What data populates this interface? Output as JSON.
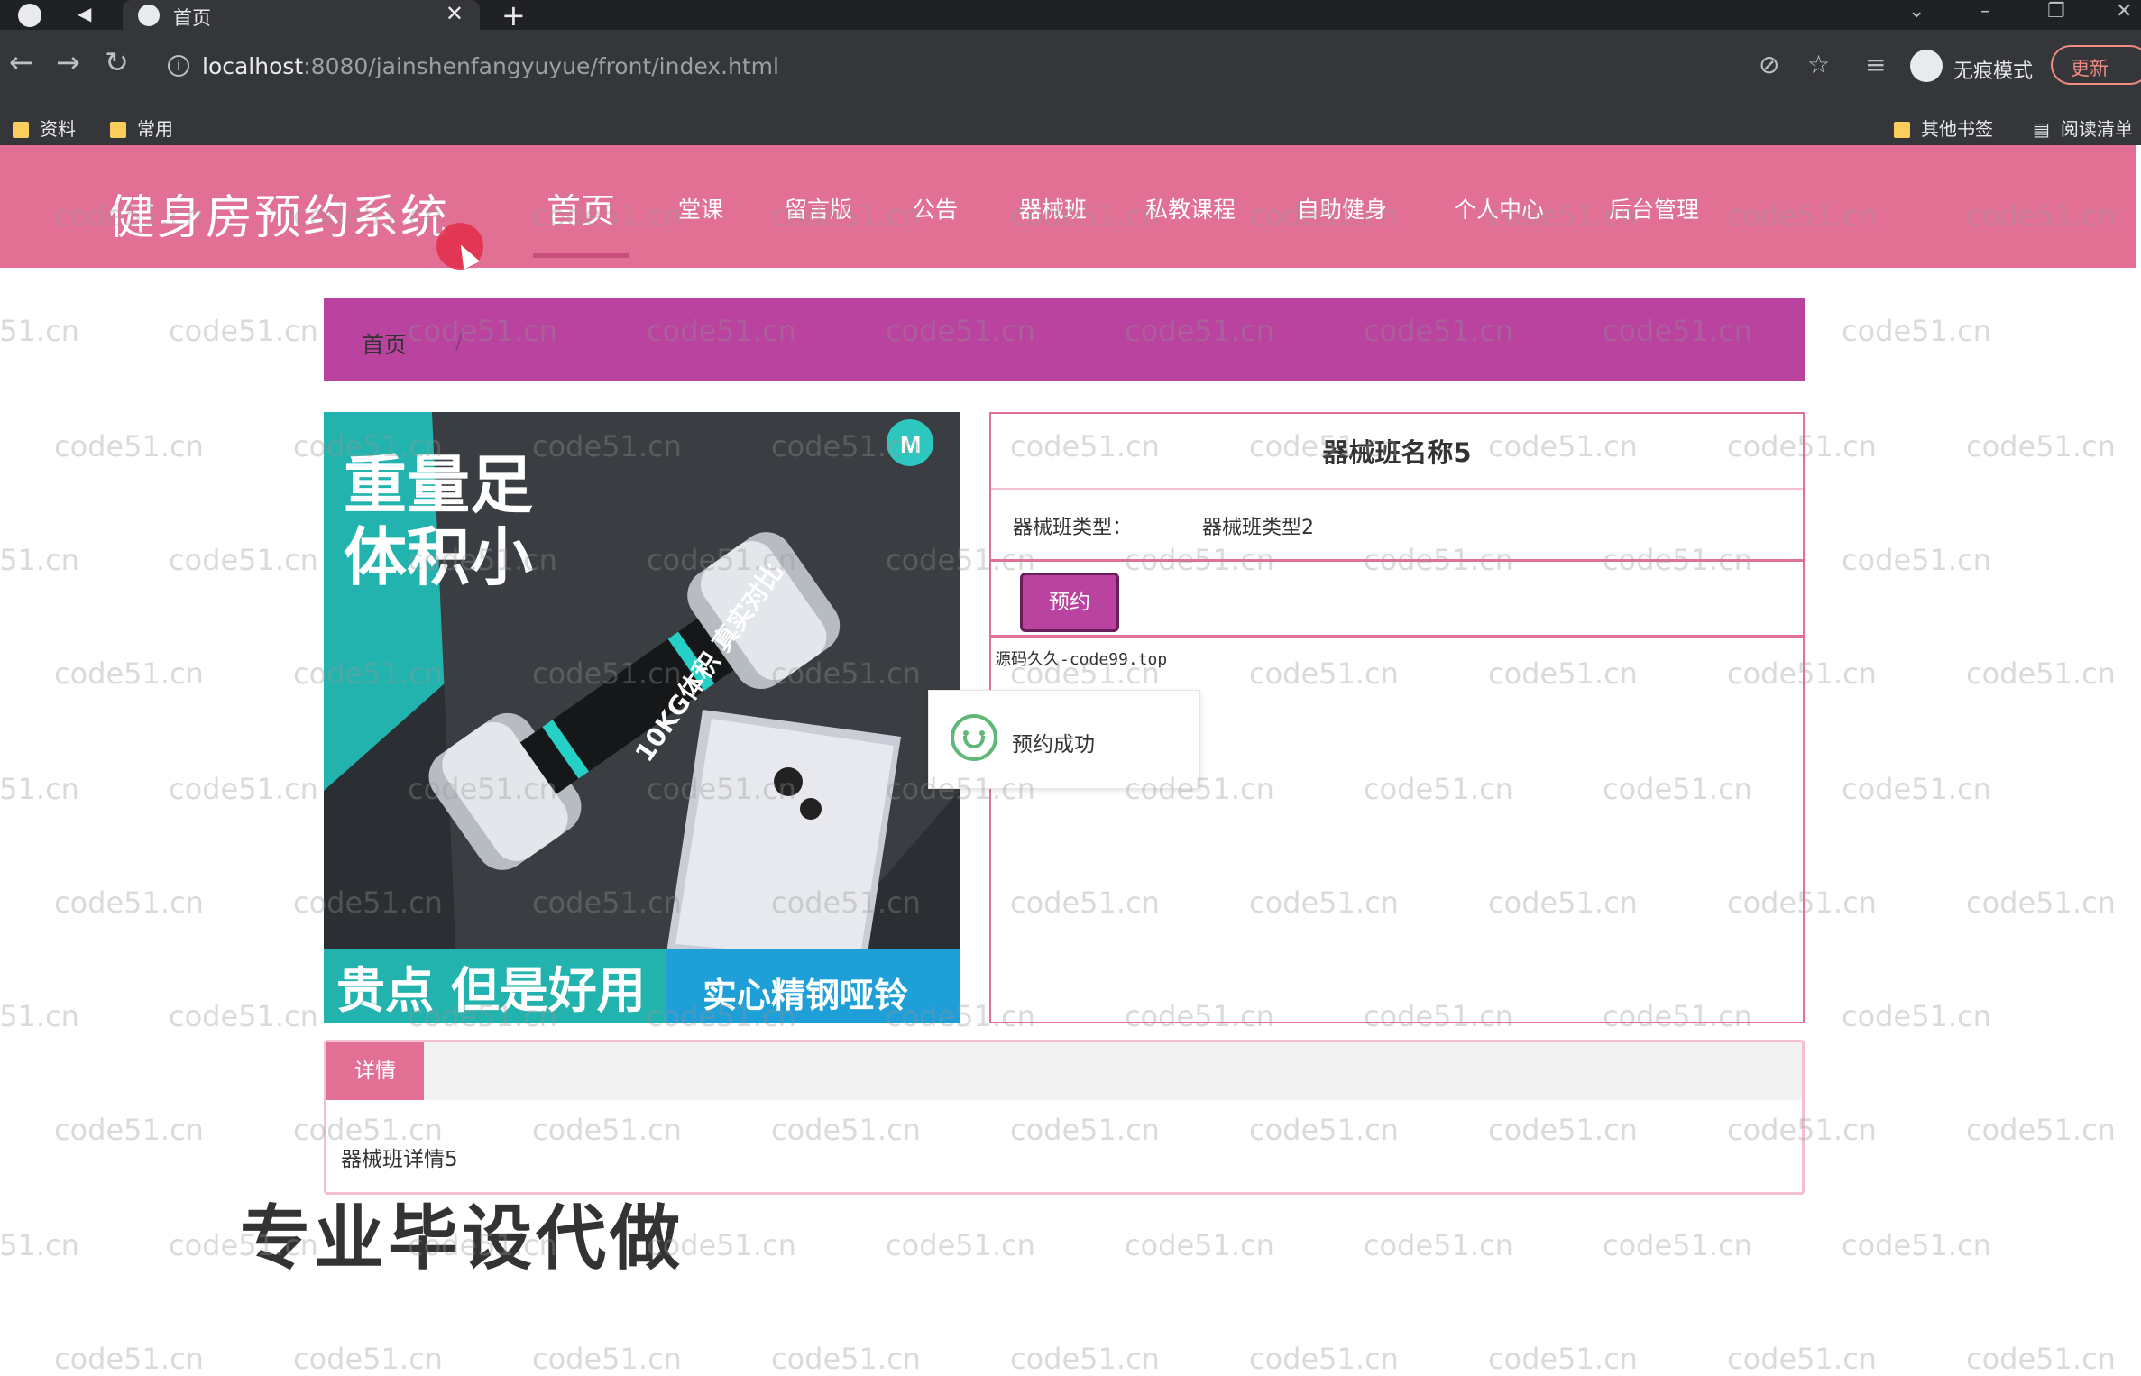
{
  "browser": {
    "tab_title": "首页",
    "url_host": "localhost",
    "url_rest": ":8080/jainshenfangyuyue/front/index.html",
    "incognito_label": "无痕模式",
    "update_label": "更新",
    "bookmarks": [
      "资料",
      "常用"
    ],
    "bookmarks_right": [
      "其他书签",
      "阅读清单"
    ]
  },
  "site": {
    "title": "健身房预约系统",
    "nav": [
      {
        "label": "首页",
        "active": true
      },
      {
        "label": "堂课"
      },
      {
        "label": "留言版"
      },
      {
        "label": "公告"
      },
      {
        "label": "器械班"
      },
      {
        "label": "私教课程"
      },
      {
        "label": "自助健身"
      },
      {
        "label": "个人中心"
      },
      {
        "label": "后台管理"
      }
    ]
  },
  "breadcrumb": {
    "home": "首页",
    "separator": "/"
  },
  "product": {
    "name": "器械班名称5",
    "type_label": "器械班类型：",
    "type_value": "器械班类型2",
    "reserve_label": "预约",
    "source_text": "源码久久-code99.top",
    "image": {
      "headline_1": "重量足",
      "headline_2": "体积小",
      "dumbbell_text": "10KG体积 真实对比",
      "banner_left": "贵点 但是好用",
      "banner_right": "实心精钢哑铃",
      "brand_letter": "M"
    }
  },
  "toast": {
    "message": "预约成功"
  },
  "detail": {
    "tab_label": "详情",
    "body": "器械班详情5"
  },
  "overlay": {
    "promo_text": "专业毕设代做",
    "watermark": "code51.cn"
  },
  "colors": {
    "header_pink": "#e27095",
    "breadcrumb_purple": "#b9439f",
    "success_green": "#5fb878"
  }
}
